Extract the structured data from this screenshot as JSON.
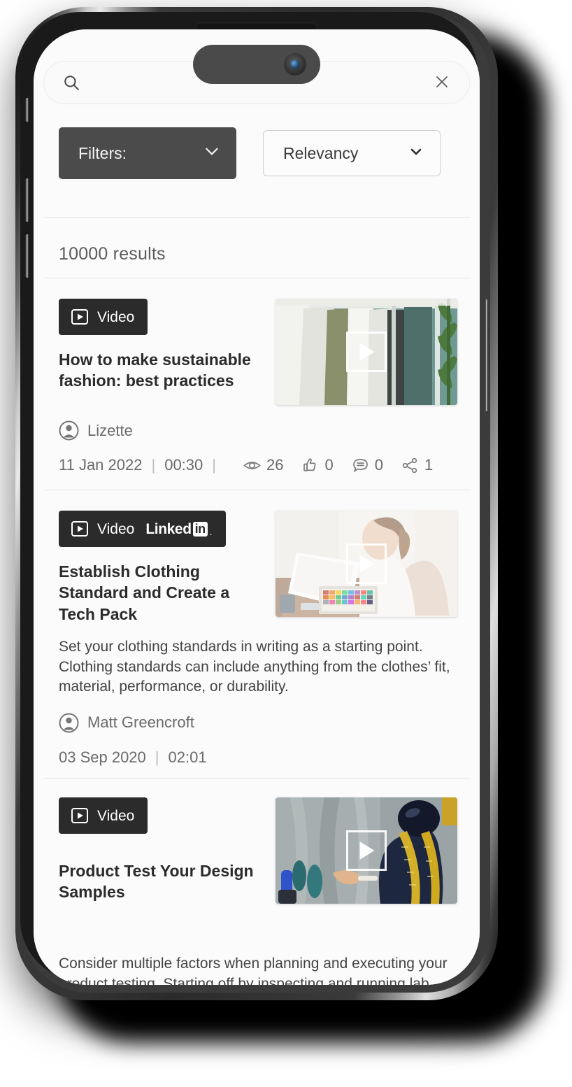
{
  "device": {
    "type": "smartphone-mockup",
    "frame_color": "#2b2b2b",
    "screen_background": "#fbfbfb"
  },
  "search": {
    "value": "",
    "placeholder": "",
    "search_icon": "search-icon",
    "clear_icon": "close-icon"
  },
  "controls": {
    "filters_label": "Filters:",
    "filters_chevron": "chevron-down-icon",
    "filters_bg": "#4b4b4b",
    "sort_label": "Relevancy",
    "sort_chevron": "chevron-down-icon"
  },
  "results": {
    "count_label": "10000 results",
    "items": [
      {
        "badge": {
          "label": "Video",
          "play_icon": "play-box-icon",
          "linkedin": false
        },
        "title": "How to make sustainable fashion: best practices",
        "description": "",
        "author": {
          "name": "Lizette",
          "avatar_icon": "user-circle-icon"
        },
        "date": "11 Jan 2022",
        "duration": "00:30",
        "stats": [
          {
            "icon": "eye-icon",
            "value": "26"
          },
          {
            "icon": "thumbs-up-icon",
            "value": "0"
          },
          {
            "icon": "comment-icon",
            "value": "0"
          },
          {
            "icon": "share-icon",
            "value": "1"
          }
        ],
        "thumbnail": {
          "alt": "clothing rack of shirts and jackets with a plant on teal background",
          "play_icon": "play-icon"
        }
      },
      {
        "badge": {
          "label": "Video",
          "play_icon": "play-box-icon",
          "linkedin": true,
          "linkedin_word": "Linked",
          "linkedin_in": "in"
        },
        "title": "Establish Clothing Standard and Create a Tech Pack",
        "description": "Set your clothing standards in writing as a starting point. Clothing standards can include anything from the clothes’ fit, material, performance, or durability.",
        "author": {
          "name": "Matt Greencroft",
          "avatar_icon": "user-circle-icon"
        },
        "date": "03 Sep 2020",
        "duration": "02:01",
        "stats": [],
        "thumbnail": {
          "alt": "woman at desk reviewing documents and color swatch palette",
          "play_icon": "play-icon"
        }
      },
      {
        "badge": {
          "label": "Video",
          "play_icon": "play-box-icon",
          "linkedin": false
        },
        "title": "Product Test Your Design Samples",
        "description": "Consider multiple factors when planning and executing your product testing. Starting off by inspecting and running lab tests on your garment’s raw materials...",
        "author": {
          "name": "",
          "avatar_icon": ""
        },
        "date": "",
        "duration": "",
        "stats": [],
        "thumbnail": {
          "alt": "tailor dress form with navy jacket and yellow measuring tape",
          "play_icon": "play-icon"
        }
      }
    ]
  }
}
